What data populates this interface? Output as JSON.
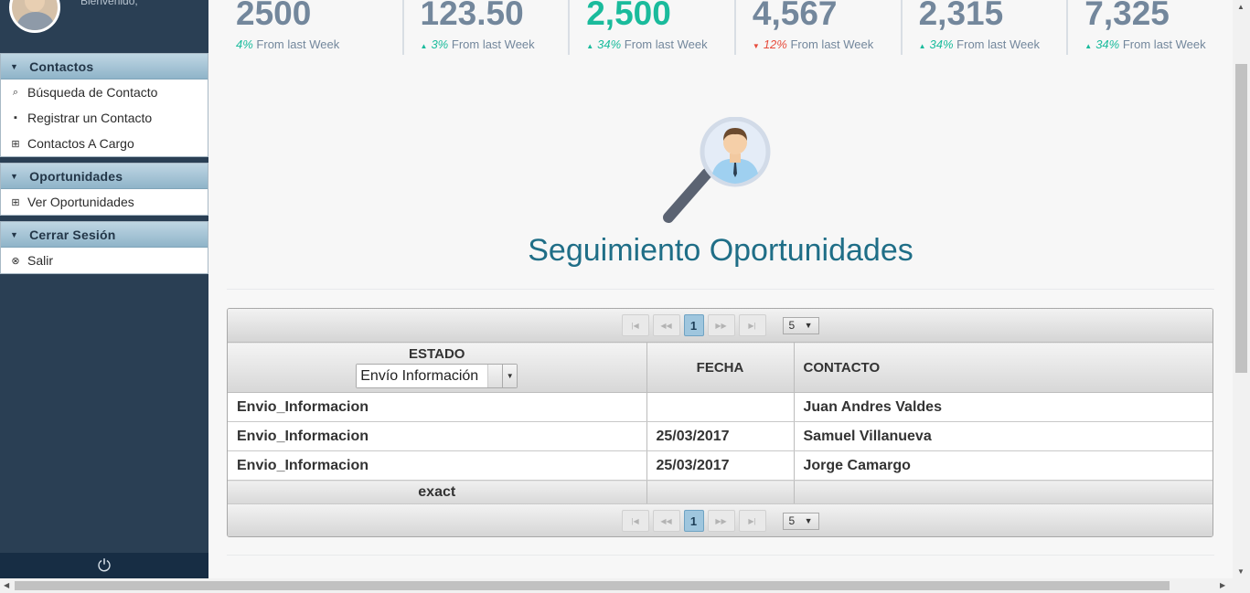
{
  "sidebar": {
    "welcome": "Bienvenido,",
    "sections": [
      {
        "title": "Contactos",
        "items": [
          {
            "label": "Búsqueda de Contacto",
            "icon": "search-icon"
          },
          {
            "label": "Registrar un Contacto",
            "icon": "save-icon"
          },
          {
            "label": "Contactos A Cargo",
            "icon": "grid-icon"
          }
        ]
      },
      {
        "title": "Oportunidades",
        "items": [
          {
            "label": "Ver Oportunidades",
            "icon": "grid-icon"
          }
        ]
      },
      {
        "title": "Cerrar Sesión",
        "items": [
          {
            "label": "Salir",
            "icon": "close-circle-icon"
          }
        ]
      }
    ]
  },
  "stats": [
    {
      "value": "2500",
      "pct": "4%",
      "suffix": "From last Week",
      "trend": "none",
      "highlight": false
    },
    {
      "value": "123.50",
      "pct": "3%",
      "suffix": "From last Week",
      "trend": "up",
      "highlight": false
    },
    {
      "value": "2,500",
      "pct": "34%",
      "suffix": "From last Week",
      "trend": "up",
      "highlight": true
    },
    {
      "value": "4,567",
      "pct": "12%",
      "suffix": "From last Week",
      "trend": "down",
      "highlight": false
    },
    {
      "value": "2,315",
      "pct": "34%",
      "suffix": "From last Week",
      "trend": "up",
      "highlight": false
    },
    {
      "value": "7,325",
      "pct": "34%",
      "suffix": "From last Week",
      "trend": "up",
      "highlight": false
    }
  ],
  "page_title": "Seguimiento Oportunidades",
  "table": {
    "pager": {
      "page": "1",
      "rows_per_page": "5"
    },
    "columns": [
      "ESTADO",
      "FECHA",
      "CONTACTO"
    ],
    "estado_filter": "Envío Información",
    "rows": [
      {
        "estado": "Envio_Informacion",
        "fecha": "",
        "contacto": "Juan Andres Valdes"
      },
      {
        "estado": "Envio_Informacion",
        "fecha": "25/03/2017",
        "contacto": "Samuel Villanueva"
      },
      {
        "estado": "Envio_Informacion",
        "fecha": "25/03/2017",
        "contacto": "Jorge Camargo"
      }
    ],
    "footer": "exact"
  },
  "colors": {
    "sidebar": "#2a3f54",
    "accent_green": "#1abb9c",
    "title": "#1f6e87",
    "down_red": "#e74c3c"
  }
}
